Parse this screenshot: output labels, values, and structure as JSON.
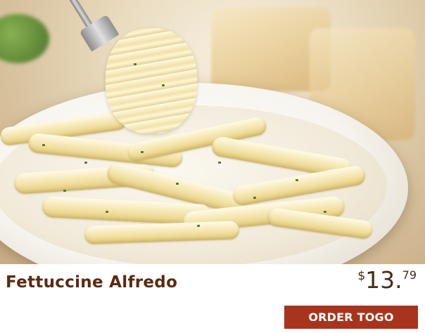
{
  "menu_item": {
    "name": "Fettuccine Alfredo",
    "price": {
      "currency": "$",
      "dollars": "13.",
      "cents": "79"
    },
    "order_button_label": "ORDER TOGO"
  },
  "colors": {
    "title_text": "#5a2a12",
    "price_text": "#4a2a18",
    "button_bg": "#a8341e",
    "button_text": "#ffffff"
  }
}
